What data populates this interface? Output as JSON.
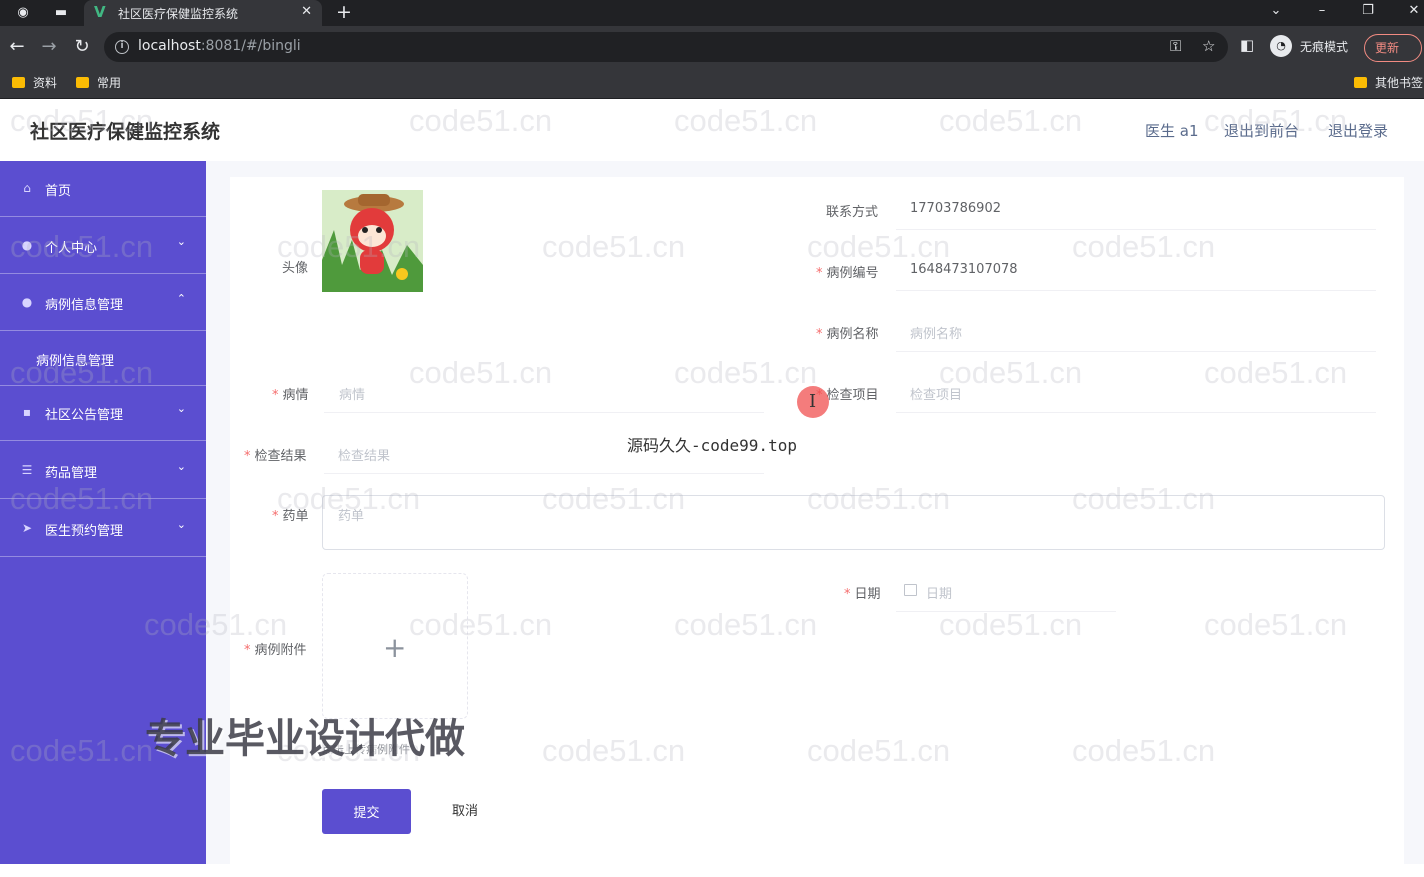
{
  "browser": {
    "tab_title": "社区医疗保健监控系统",
    "url_host": "localhost",
    "url_path": ":8081/#/bingli",
    "profile_label": "无痕模式",
    "update_label": "更新",
    "bookmarks": [
      "资料",
      "常用"
    ],
    "other_bookmarks": "其他书签"
  },
  "header": {
    "title": "社区医疗保健监控系统",
    "user": "医生 a1",
    "to_front": "退出到前台",
    "logout": "退出登录"
  },
  "sidebar": {
    "items": [
      {
        "label": "首页",
        "icon": "home-icon"
      },
      {
        "label": "个人中心",
        "icon": "user-icon"
      },
      {
        "label": "病例信息管理",
        "icon": "user-icon"
      },
      {
        "label": "病例信息管理"
      },
      {
        "label": "社区公告管理",
        "icon": "notice-icon"
      },
      {
        "label": "药品管理",
        "icon": "list-icon"
      },
      {
        "label": "医生预约管理",
        "icon": "send-icon"
      }
    ]
  },
  "form": {
    "avatar_label": "头像",
    "contact_label": "联系方式",
    "contact_value": "17703786902",
    "case_no_label": "病例编号",
    "case_no_value": "1648473107078",
    "case_name_label": "病例名称",
    "case_name_placeholder": "病例名称",
    "condition_label": "病情",
    "condition_placeholder": "病情",
    "exam_item_label": "检查项目",
    "exam_item_placeholder": "检查项目",
    "exam_result_label": "检查结果",
    "exam_result_placeholder": "检查结果",
    "prescription_label": "药单",
    "prescription_placeholder": "药单",
    "date_label": "日期",
    "date_placeholder": "日期",
    "attachment_label": "病例附件",
    "attachment_tip": "点击上传病例附件",
    "submit_label": "提交",
    "cancel_label": "取消"
  },
  "overlays": {
    "watermark": "code51.cn",
    "source_note": "源码久久-code99.top",
    "promo": "专业毕业设计代做"
  },
  "colors": {
    "sidebar_bg": "#5b4ed0",
    "required": "#f56c6c",
    "submit_bg": "#5b4ed0"
  }
}
